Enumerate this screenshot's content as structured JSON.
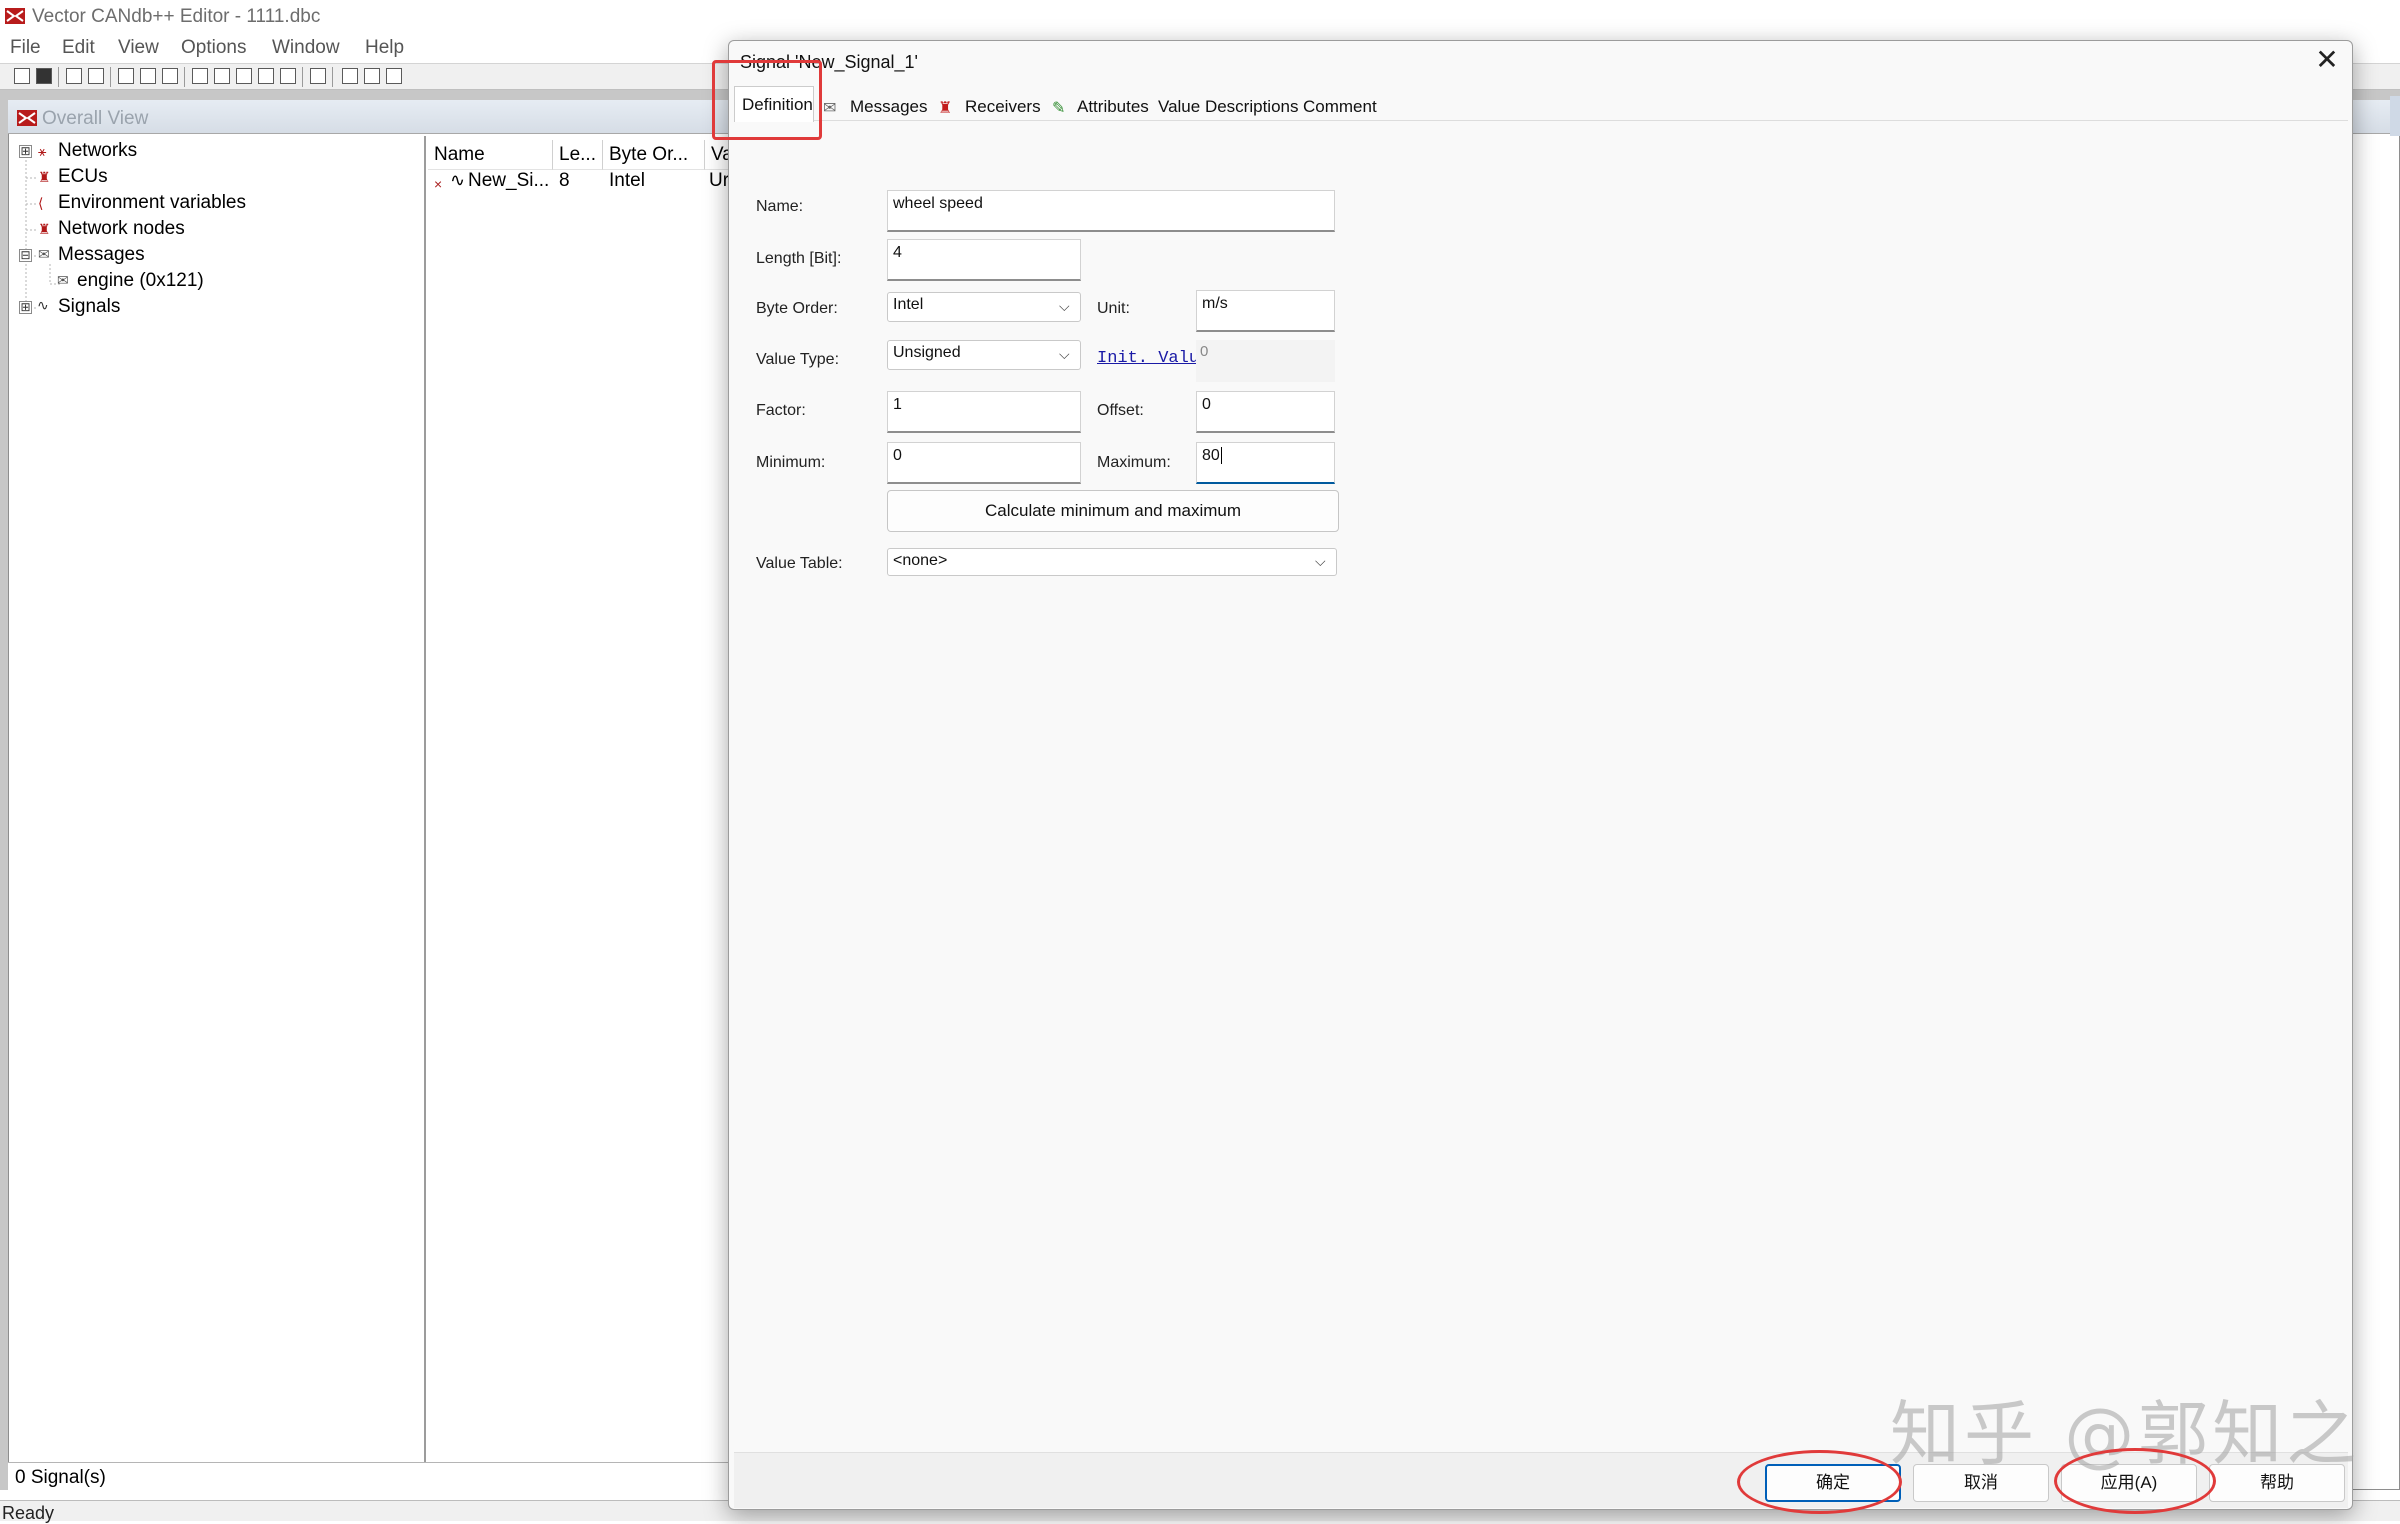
{
  "app": {
    "title": "Vector CANdb++ Editor - 1111.dbc",
    "menu": [
      "File",
      "Edit",
      "View",
      "Options",
      "Window",
      "Help"
    ],
    "status": "Ready"
  },
  "overall_view": {
    "title": "Overall View",
    "tree": [
      {
        "label": "Networks",
        "expander": "⊞",
        "icon": "network-icon"
      },
      {
        "label": "ECUs",
        "icon": "ecu-icon"
      },
      {
        "label": "Environment variables",
        "icon": "env-var-icon"
      },
      {
        "label": "Network nodes",
        "icon": "node-icon"
      },
      {
        "label": "Messages",
        "expander": "⊟",
        "icon": "message-icon"
      },
      {
        "label": "engine (0x121)",
        "icon": "message-icon"
      },
      {
        "label": "Signals",
        "expander": "⊞",
        "icon": "signal-icon"
      }
    ],
    "list": {
      "columns": [
        "Name",
        "Le...",
        "Byte Or...",
        "Va"
      ],
      "rows": [
        {
          "marker": "×",
          "name": "New_Si...",
          "length": "8",
          "byte_order": "Intel",
          "value_type": "Ur"
        }
      ]
    },
    "status": "0 Signal(s)"
  },
  "dialog": {
    "title": "Signal 'New_Signal_1'",
    "close": "✕",
    "tabs": [
      "Definition",
      "Messages",
      "Receivers",
      "Attributes",
      "Value Descriptions",
      "Comment"
    ],
    "fields": {
      "name_label": "Name:",
      "name_value": "wheel speed",
      "length_label": "Length [Bit]:",
      "length_value": "4",
      "byte_order_label": "Byte Order:",
      "byte_order_value": "Intel",
      "unit_label": "Unit:",
      "unit_value": "m/s",
      "value_type_label": "Value Type:",
      "value_type_value": "Unsigned",
      "init_value_link": "Init. Value",
      "init_value_value": "0",
      "factor_label": "Factor:",
      "factor_value": "1",
      "offset_label": "Offset:",
      "offset_value": "0",
      "minimum_label": "Minimum:",
      "minimum_value": "0",
      "maximum_label": "Maximum:",
      "maximum_value": "80",
      "calc_button": "Calculate minimum and maximum",
      "value_table_label": "Value Table:",
      "value_table_value": "<none>"
    },
    "buttons": {
      "ok": "确定",
      "cancel": "取消",
      "apply": "应用(A)",
      "help": "帮助"
    }
  },
  "watermark": "知乎 @郭知之",
  "colors": {
    "annotation_red": "#e03a3a",
    "accent_blue": "#005fb8",
    "link_blue": "#1a1aa6"
  }
}
